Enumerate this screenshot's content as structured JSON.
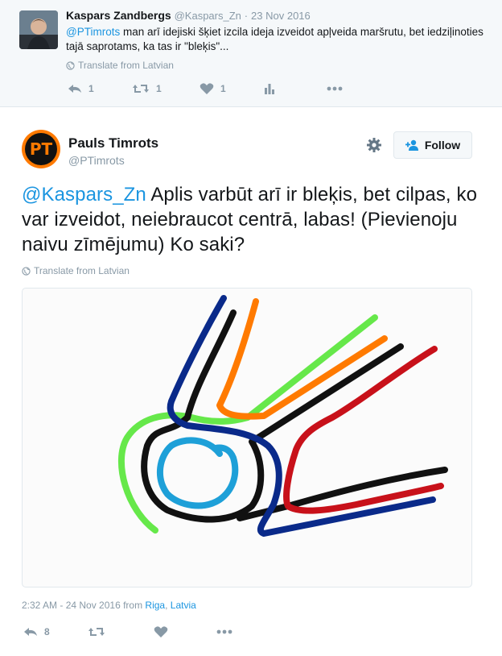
{
  "parent_tweet": {
    "author_name": "Kaspars Zandbergs",
    "handle": "@Kaspars_Zn",
    "separator": "·",
    "date": "23 Nov 2016",
    "mention": "@PTimrots",
    "text_rest": " man arī idejiski šķiet izcila ideja izveidot apļveida maršrutu, bet iedziļinoties tajā saprotams, ka tas ir \"bleķis\"...",
    "translate_label": "Translate from Latvian",
    "actions": {
      "reply_count": "1",
      "retweet_count": "1",
      "like_count": "1"
    }
  },
  "main_tweet": {
    "author_name": "Pauls Timrots",
    "handle": "@PTimrots",
    "avatar_initials": "PT",
    "follow_label": "Follow",
    "mention": "@Kaspars_Zn",
    "text_rest": " Aplis varbūt arī ir bleķis, bet cilpas, ko var izveidot, neiebraucot centrā, labas! (Pievienoju naivu zīmējumu) Ko saki?",
    "translate_label": "Translate from Latvian",
    "timestamp": "2:32 AM - 24 Nov 2016",
    "from_label": " from ",
    "location_city": "Riga",
    "location_sep": ", ",
    "location_country": "Latvia",
    "actions": {
      "reply_count": "8"
    }
  },
  "colors": {
    "link": "#1b95e0",
    "muted": "#8899a6",
    "drawing_blue_dark": "#0a2a8a",
    "drawing_orange": "#ff7a00",
    "drawing_black": "#111111",
    "drawing_green": "#66e84a",
    "drawing_red": "#c8111a",
    "drawing_blue_light": "#1ea0d8"
  }
}
